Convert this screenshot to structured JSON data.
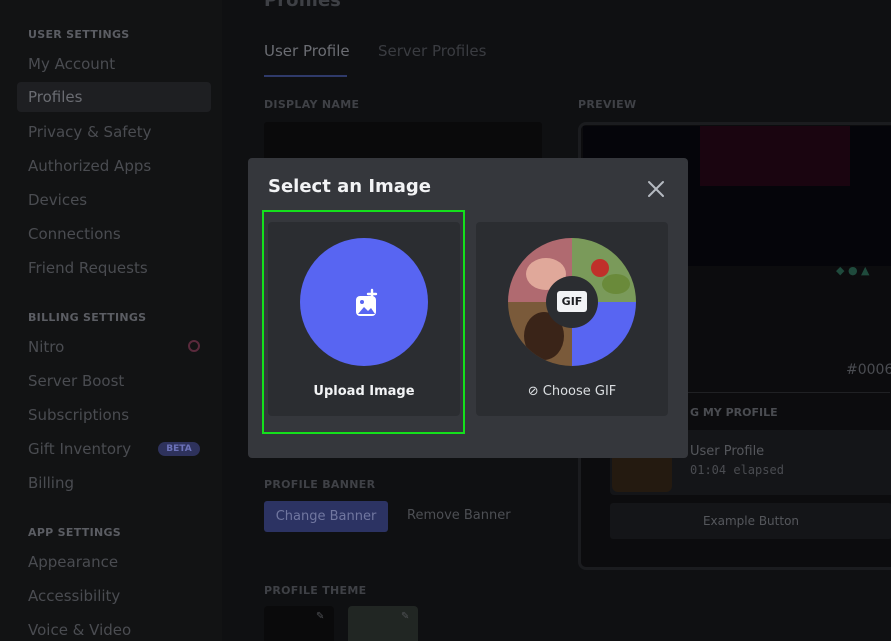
{
  "sidebar": {
    "sections": [
      {
        "heading": "USER SETTINGS",
        "items": [
          "My Account",
          "Profiles",
          "Privacy & Safety",
          "Authorized Apps",
          "Devices",
          "Connections",
          "Friend Requests"
        ]
      },
      {
        "heading": "BILLING SETTINGS",
        "items": [
          "Nitro",
          "Server Boost",
          "Subscriptions",
          "Gift Inventory",
          "Billing"
        ]
      },
      {
        "heading": "APP SETTINGS",
        "items": [
          "Appearance",
          "Accessibility",
          "Voice & Video"
        ]
      }
    ],
    "active_item": "Profiles",
    "beta_badge": "BETA"
  },
  "page": {
    "title": "Profiles",
    "tabs": [
      "User Profile",
      "Server Profiles"
    ],
    "active_tab": "User Profile"
  },
  "profile_form": {
    "display_name_label": "DISPLAY NAME",
    "preview_label": "PREVIEW",
    "profile_banner_label": "PROFILE BANNER",
    "change_banner_label": "Change Banner",
    "remove_banner_label": "Remove Banner",
    "profile_theme_label": "PROFILE THEME"
  },
  "preview": {
    "discriminator": "#0006",
    "playing_label": "G MY PROFILE",
    "activity_title": "User Profile",
    "activity_elapsed": "01:04 elapsed",
    "example_button": "Example Button"
  },
  "modal": {
    "title": "Select an Image",
    "upload_label": "Upload Image",
    "gif_label": "Choose GIF",
    "gif_tag": "GIF",
    "colors": {
      "modal_bg": "#35373c",
      "card_bg": "#2b2d31",
      "blurple": "#5865f2",
      "highlight": "#14e01c"
    }
  }
}
